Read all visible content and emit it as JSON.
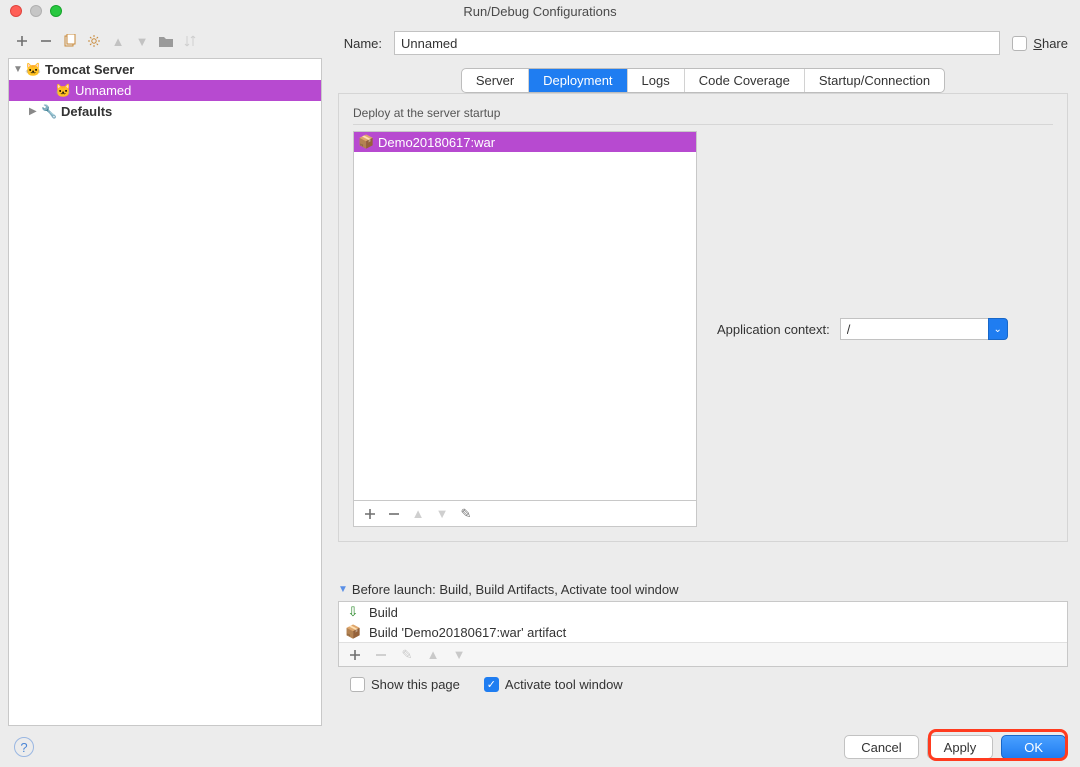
{
  "window": {
    "title": "Run/Debug Configurations"
  },
  "tree": {
    "root": {
      "label": "Tomcat Server"
    },
    "child": {
      "label": "Unnamed"
    },
    "defaults": {
      "label": "Defaults"
    }
  },
  "form": {
    "name_label": "Name:",
    "name_value": "Unnamed",
    "share_label": "Share"
  },
  "tabs": {
    "server": "Server",
    "deployment": "Deployment",
    "logs": "Logs",
    "coverage": "Code Coverage",
    "startup": "Startup/Connection"
  },
  "deploy": {
    "section_label": "Deploy at the server startup",
    "artifact": "Demo20180617:war",
    "app_context_label": "Application context:",
    "app_context_value": "/"
  },
  "before": {
    "header": "Before launch: Build, Build Artifacts, Activate tool window",
    "task1": "Build",
    "task2": "Build 'Demo20180617:war' artifact",
    "show_page": "Show this page",
    "activate": "Activate tool window"
  },
  "buttons": {
    "cancel": "Cancel",
    "apply": "Apply",
    "ok": "OK"
  }
}
